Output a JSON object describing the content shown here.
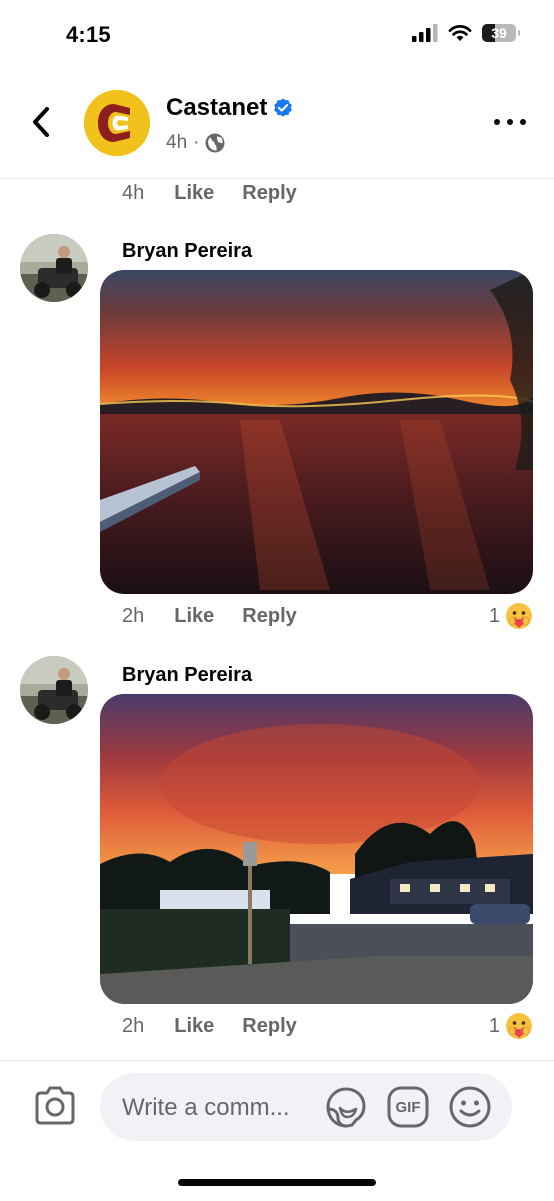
{
  "status_bar": {
    "time": "4:15",
    "battery": "39"
  },
  "header": {
    "page_name": "Castanet",
    "post_time": "4h",
    "separator": "·",
    "icons": [
      "back-arrow-icon",
      "castanet-logo",
      "verified-badge-icon",
      "globe-icon",
      "more-icon"
    ]
  },
  "prev_comment": {
    "time": "4h",
    "like": "Like",
    "reply": "Reply"
  },
  "comments": [
    {
      "author": "Bryan Pereira",
      "photo": "wildfire-over-lake-photo",
      "time": "2h",
      "like": "Like",
      "reply": "Reply",
      "reaction_count": "1",
      "reaction": "care-emoji"
    },
    {
      "author": "Bryan Pereira",
      "photo": "wildfire-behind-houses-photo",
      "time": "2h",
      "like": "Like",
      "reply": "Reply",
      "reaction_count": "1",
      "reaction": "care-emoji"
    }
  ],
  "composer": {
    "placeholder": "Write a comm...",
    "gif_label": "GIF",
    "icons": [
      "camera-icon",
      "sticker-icon",
      "gif-icon",
      "emoji-icon"
    ]
  },
  "colors": {
    "verified": "#1877f2",
    "logo_bg": "#f1c21b",
    "logo_mark": "#8e1f1f",
    "secondary_text": "#65676b"
  }
}
